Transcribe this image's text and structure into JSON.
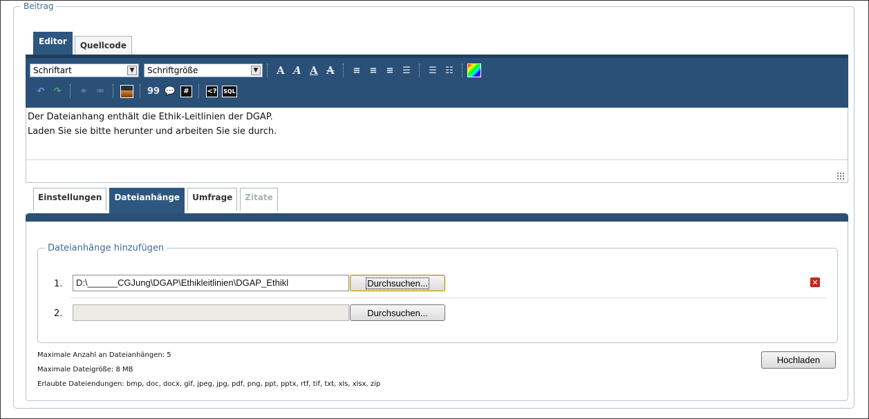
{
  "beitrag": {
    "legend": "Beitrag"
  },
  "editor_tabs": [
    "Editor",
    "Quellcode"
  ],
  "toolbar": {
    "font_select": "Schriftart",
    "size_select": "Schriftgröße",
    "quote_label": "99",
    "hash_label": "#",
    "code_label": "<?",
    "sql_label": "SQL"
  },
  "editor": {
    "line1": "Der Dateianhang enthält die Ethik-Leitlinien der DGAP.",
    "line2": "Laden Sie sie bitte herunter und arbeiten Sie sie durch."
  },
  "bottom_tabs": [
    "Einstellungen",
    "Dateianhänge",
    "Umfrage",
    "Zitate"
  ],
  "attachments": {
    "legend": "Dateianhänge hinzufügen",
    "rows": [
      {
        "num": "1.",
        "value": "D:\\______CGJung\\DGAP\\Ethikleitlinien\\DGAP_Ethikl",
        "button": "Durchsuchen..."
      },
      {
        "num": "2.",
        "value": "",
        "button": "Durchsuchen..."
      }
    ],
    "upload_button": "Hochladen"
  },
  "info": {
    "max_count": "Maximale Anzahl an Dateianhängen: 5",
    "max_size": "Maximale Dateigröße: 8 MB",
    "extensions": "Erlaubte Dateiendungen: bmp, doc, docx, gif, jpeg, jpg, pdf, png, ppt, pptx, rtf, tif, txt, xls, xlsx, zip"
  },
  "colors": {
    "toolbar": "#2b5077",
    "active_tab": "#2e5780",
    "legend": "#3f6b94",
    "delete": "#c8251f"
  }
}
